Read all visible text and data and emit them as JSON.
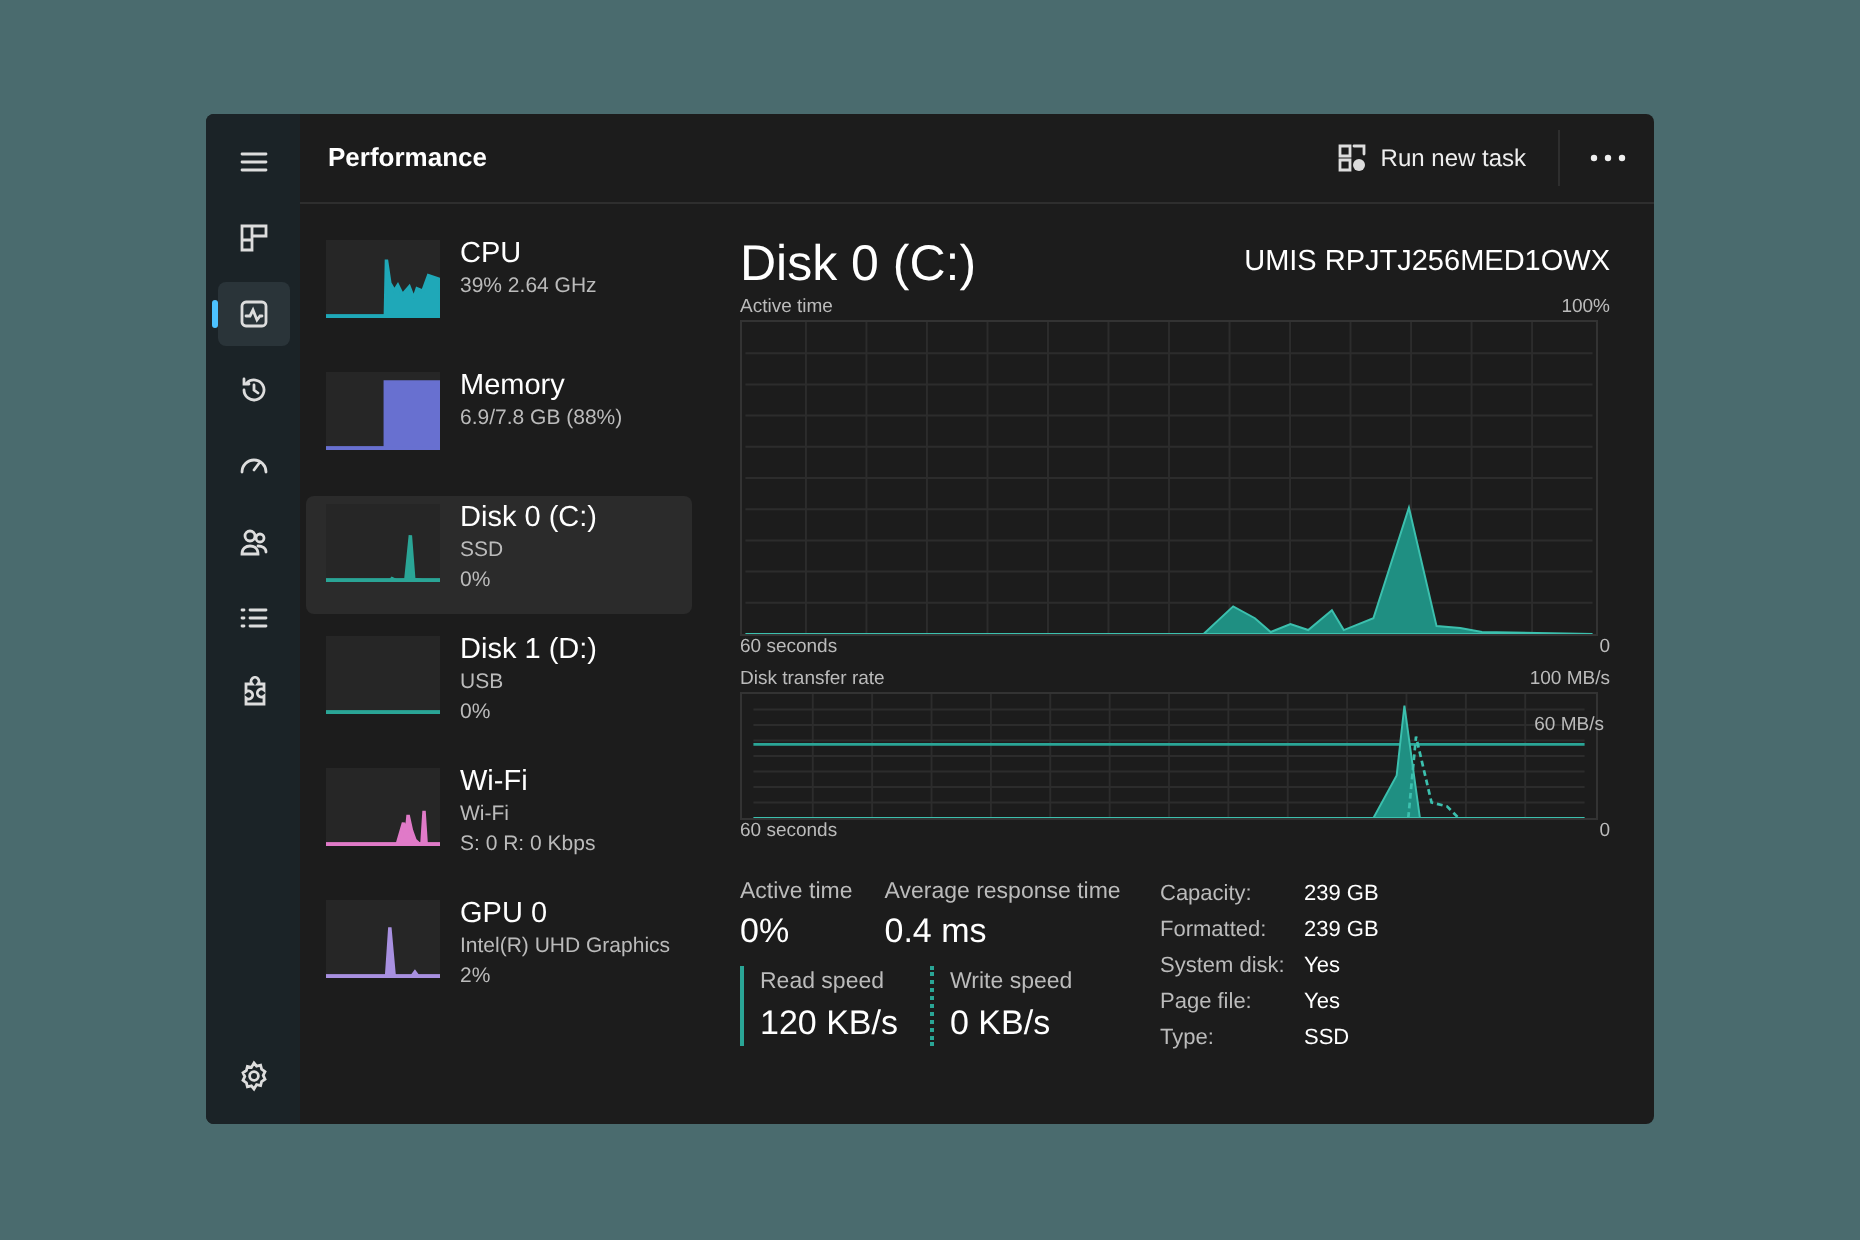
{
  "nav_rail": {
    "items": [
      {
        "selected": false
      },
      {
        "selected": false
      },
      {
        "selected": true
      },
      {
        "selected": false
      },
      {
        "selected": false
      },
      {
        "selected": false
      },
      {
        "selected": false
      },
      {
        "selected": false
      }
    ]
  },
  "header": {
    "title": "Performance",
    "run_task_button": "Run new task"
  },
  "devices": [
    {
      "name": "CPU",
      "lines": [
        "39%  2.64 GHz"
      ],
      "color": "#1fa8b8",
      "selected": false
    },
    {
      "name": "Memory",
      "lines": [
        "6.9/7.8 GB (88%)"
      ],
      "color": "#6870d0",
      "selected": false
    },
    {
      "name": "Disk 0 (C:)",
      "lines": [
        "SSD",
        "0%"
      ],
      "color": "#2aa596",
      "selected": true
    },
    {
      "name": "Disk 1 (D:)",
      "lines": [
        "USB",
        "0%"
      ],
      "color": "#2aa596",
      "selected": false
    },
    {
      "name": "Wi-Fi",
      "lines": [
        "Wi-Fi",
        "S: 0 R: 0 Kbps"
      ],
      "color": "#e07ac8",
      "selected": false
    },
    {
      "name": "GPU 0",
      "lines": [
        "Intel(R) UHD Graphics",
        "2%"
      ],
      "color": "#a890e0",
      "selected": false
    }
  ],
  "detail": {
    "title": "Disk 0 (C:)",
    "model": "UMIS RPJTJ256MED1OWX",
    "active_time_graph": {
      "label": "Active time",
      "max": "100%",
      "span": "60 seconds",
      "min": "0"
    },
    "transfer_graph": {
      "label": "Disk transfer rate",
      "max": "100 MB/s",
      "marker": "60 MB/s",
      "span": "60 seconds",
      "min": "0"
    },
    "stats": [
      {
        "label": "Active time",
        "value": "0%"
      },
      {
        "label": "Average response time",
        "value": "0.4 ms"
      }
    ],
    "speeds": [
      {
        "kind": "read",
        "label": "Read speed",
        "value": "120 KB/s"
      },
      {
        "kind": "write",
        "label": "Write speed",
        "value": "0 KB/s"
      }
    ],
    "properties": [
      {
        "label": "Capacity:",
        "value": "239 GB"
      },
      {
        "label": "Formatted:",
        "value": "239 GB"
      },
      {
        "label": "System disk:",
        "value": "Yes"
      },
      {
        "label": "Page file:",
        "value": "Yes"
      },
      {
        "label": "Type:",
        "value": "SSD"
      }
    ]
  }
}
